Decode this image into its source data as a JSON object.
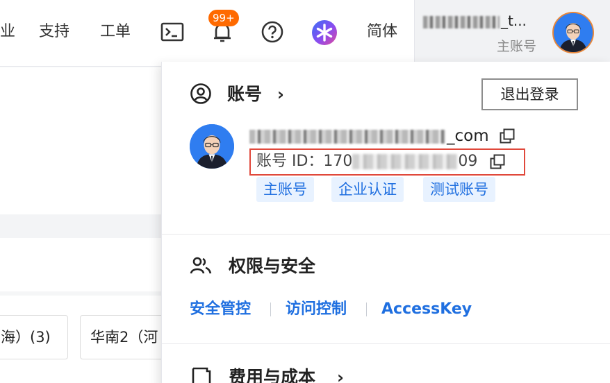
{
  "topbar": {
    "nav_items": [
      "业",
      "支持",
      "工单",
      "简体"
    ],
    "notification_badge": "99+",
    "account_name_visible": "_t...",
    "account_role": "主账号",
    "icons": [
      "terminal-icon",
      "bell-icon",
      "help-icon",
      "ai-assistant-icon"
    ]
  },
  "background": {
    "region_tabs": [
      "海）(3)",
      "华南2（河"
    ]
  },
  "dropdown": {
    "account_title": "账号",
    "logout_label": "退出登录",
    "email_suffix": "_com",
    "account_id_prefix": "账号 ID：170",
    "account_id_suffix": "09",
    "tags": [
      "主账号",
      "企业认证",
      "测试账号"
    ],
    "security_title": "权限与安全",
    "security_links": [
      "安全管控",
      "访问控制",
      "AccessKey"
    ],
    "billing_title": "费用与成本"
  },
  "colors": {
    "accent": "#1f6fe0",
    "tag_bg": "#e8f2ff",
    "badge": "#ff6a00",
    "highlight_box": "#e0483b"
  }
}
